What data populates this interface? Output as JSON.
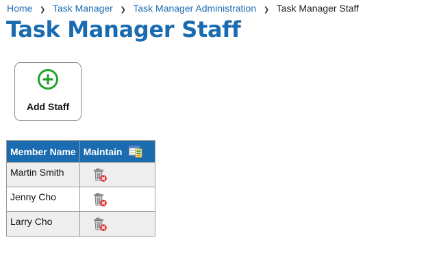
{
  "breadcrumb": {
    "items": [
      "Home",
      "Task Manager",
      "Task Manager Administration"
    ],
    "current": "Task Manager Staff"
  },
  "page": {
    "title": "Task Manager Staff"
  },
  "add_button": {
    "label": "Add Staff",
    "icon": "plus-circle-icon"
  },
  "table": {
    "headers": {
      "name": "Member Name",
      "maintain": "Maintain"
    },
    "header_icon": "grid-columns-icon",
    "rows": [
      {
        "name": "Martin Smith",
        "action_icon": "delete-trash-icon"
      },
      {
        "name": "Jenny Cho",
        "action_icon": "delete-trash-icon"
      },
      {
        "name": "Larry Cho",
        "action_icon": "delete-trash-icon"
      }
    ]
  },
  "colors": {
    "brand_blue": "#1a6bb0",
    "plus_green": "#22a32a",
    "delete_red": "#e0242c",
    "row_shade": "#eeeeee"
  }
}
